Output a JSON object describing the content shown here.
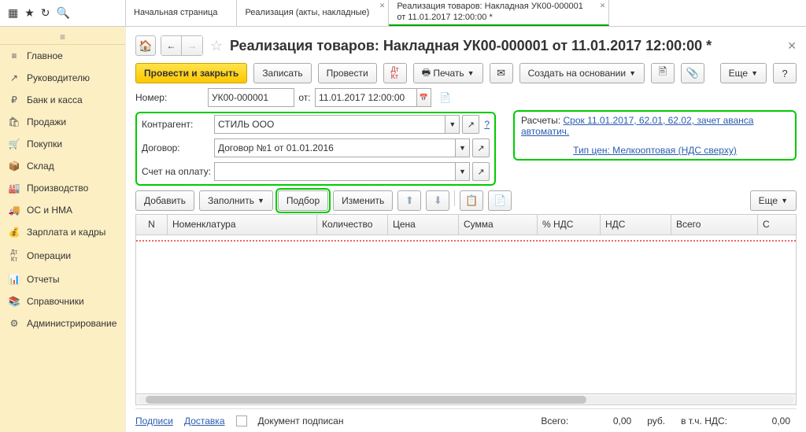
{
  "tabs": {
    "items": [
      {
        "label": "Начальная страница",
        "active": false
      },
      {
        "label": "Реализация (акты, накладные)",
        "active": false
      },
      {
        "label": "Реализация товаров: Накладная УК00-000001 от 11.01.2017 12:00:00 *",
        "active": true
      }
    ]
  },
  "sidebar": {
    "items": [
      {
        "icon": "≡",
        "label": "Главное"
      },
      {
        "icon": "↗",
        "label": "Руководителю"
      },
      {
        "icon": "₽",
        "label": "Банк и касса"
      },
      {
        "icon": "🛍",
        "label": "Продажи"
      },
      {
        "icon": "🛒",
        "label": "Покупки"
      },
      {
        "icon": "📦",
        "label": "Склад"
      },
      {
        "icon": "🏭",
        "label": "Производство"
      },
      {
        "icon": "🚚",
        "label": "ОС и НМА"
      },
      {
        "icon": "💰",
        "label": "Зарплата и кадры"
      },
      {
        "icon": "Дт Кт",
        "label": "Операции"
      },
      {
        "icon": "📊",
        "label": "Отчеты"
      },
      {
        "icon": "📚",
        "label": "Справочники"
      },
      {
        "icon": "⚙",
        "label": "Администрирование"
      }
    ]
  },
  "page": {
    "title": "Реализация товаров: Накладная УК00-000001 от 11.01.2017 12:00:00 *"
  },
  "toolbar": {
    "post_close": "Провести и закрыть",
    "write": "Записать",
    "post": "Провести",
    "print": "Печать",
    "create_based": "Создать на основании",
    "more": "Еще",
    "help": "?"
  },
  "form": {
    "number_label": "Номер:",
    "number_value": "УК00-000001",
    "from_label": "от:",
    "date_value": "11.01.2017 12:00:00",
    "counterparty_label": "Контрагент:",
    "counterparty_value": "СТИЛЬ ООО",
    "contract_label": "Договор:",
    "contract_value": "Договор №1 от 01.01.2016",
    "invoice_label": "Счет на оплату:",
    "invoice_value": ""
  },
  "settlements": {
    "label": "Расчеты:",
    "link": "Срок 11.01.2017, 62.01, 62.02, зачет аванса автоматич.",
    "price_type": "Тип цен: Мелкооптовая (НДС сверху)"
  },
  "listToolbar": {
    "add": "Добавить",
    "fill": "Заполнить",
    "pick": "Подбор",
    "change": "Изменить",
    "more": "Еще"
  },
  "table": {
    "columns": [
      "N",
      "Номенклатура",
      "Количество",
      "Цена",
      "Сумма",
      "% НДС",
      "НДС",
      "Всего",
      "С"
    ]
  },
  "footer": {
    "signatures": "Подписи",
    "delivery": "Доставка",
    "doc_signed": "Документ подписан",
    "total_label": "Всего:",
    "total_value": "0,00",
    "currency": "руб.",
    "vat_label": "в т.ч. НДС:",
    "vat_value": "0,00"
  }
}
